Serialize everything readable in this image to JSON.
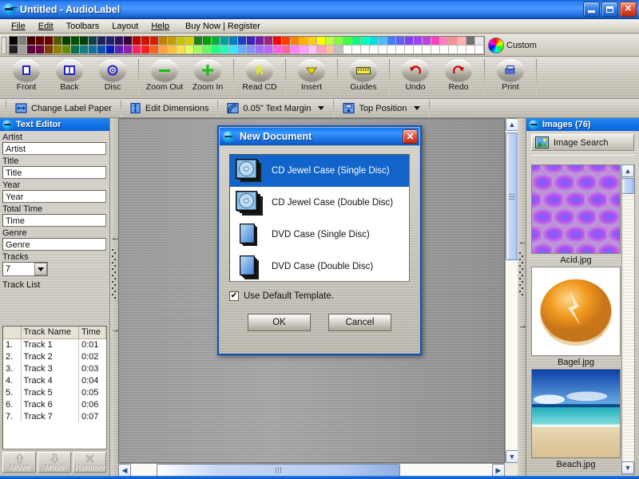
{
  "window": {
    "title": "Untitled - AudioLabel",
    "app_icon": "audiolabel-icon",
    "minimize_label": "Minimize",
    "maximize_label": "Restore",
    "close_label": "Close"
  },
  "menu": {
    "items": [
      {
        "label": "File",
        "accel": "F"
      },
      {
        "label": "Edit",
        "accel": "E"
      },
      {
        "label": "Toolbars",
        "accel": "T"
      },
      {
        "label": "Layout",
        "accel": "L"
      },
      {
        "label": "Help",
        "accel": "H"
      },
      {
        "label": "Buy Now | Register",
        "accel": ""
      }
    ]
  },
  "palette": {
    "custom_label": "Custom",
    "row1": [
      "#000000",
      "#808080",
      "#400000",
      "#600000",
      "#700000",
      "#585800",
      "#004000",
      "#005000",
      "#004008",
      "#104040",
      "#202060",
      "#202070",
      "#301060",
      "#380038",
      "#c00000",
      "#d01000",
      "#d02000",
      "#c08000",
      "#c0a000",
      "#c8c000",
      "#d0d000",
      "#208020",
      "#00a000",
      "#00b040",
      "#00a0a0",
      "#0080c0",
      "#2040c0",
      "#4020c0",
      "#7020a0",
      "#a02080",
      "#ff0000",
      "#ff4000",
      "#ff8000",
      "#ffb000",
      "#ffd000",
      "#ffff00",
      "#c0ff40",
      "#80ff40",
      "#40ff40",
      "#00ff80",
      "#00ffc0",
      "#00e0e0",
      "#40c0ff",
      "#4080ff",
      "#6060ff",
      "#8040ff",
      "#a040ff",
      "#c040e0",
      "#ff40c0",
      "#ff80c0",
      "#ff9090",
      "#ffb0b0",
      "#707070",
      "#e8e8e8"
    ],
    "row2": [
      "#202020",
      "#a0a0a0",
      "#600040",
      "#700040",
      "#804000",
      "#908000",
      "#609000",
      "#0a7050",
      "#108080",
      "#1070a0",
      "#1050b0",
      "#0020c0",
      "#6020c0",
      "#9020b0",
      "#ff2060",
      "#ff2020",
      "#ff6020",
      "#ffa040",
      "#ffc040",
      "#ffe040",
      "#e0ff60",
      "#a0ff60",
      "#60ff60",
      "#20ff80",
      "#20ffc0",
      "#40e0ff",
      "#60b0ff",
      "#8090ff",
      "#a070ff",
      "#c060ff",
      "#ff60e0",
      "#ff60a0",
      "#ff80ff",
      "#ffa0ff",
      "#ffc0ff",
      "#ffa0c0",
      "#ffc0a0",
      "#c0c0c0",
      "#ffffff"
    ]
  },
  "toolbar1": {
    "groups": [
      {
        "buttons": [
          {
            "label": "Front",
            "icon": "front-cover-icon"
          },
          {
            "label": "Back",
            "icon": "back-cover-icon"
          },
          {
            "label": "Disc",
            "icon": "disc-icon"
          }
        ]
      },
      {
        "buttons": [
          {
            "label": "Zoom Out",
            "icon": "zoom-out-icon"
          },
          {
            "label": "Zoom In",
            "icon": "zoom-in-icon"
          }
        ]
      },
      {
        "buttons": [
          {
            "label": "Read CD",
            "icon": "read-cd-icon"
          }
        ]
      },
      {
        "buttons": [
          {
            "label": "Insert",
            "icon": "insert-icon"
          }
        ]
      },
      {
        "buttons": [
          {
            "label": "Guides",
            "icon": "guides-icon"
          }
        ]
      },
      {
        "buttons": [
          {
            "label": "Undo",
            "icon": "undo-icon"
          },
          {
            "label": "Redo",
            "icon": "redo-icon"
          }
        ]
      },
      {
        "buttons": [
          {
            "label": "Print",
            "icon": "print-icon"
          }
        ]
      }
    ]
  },
  "toolbar2": {
    "items": [
      {
        "label": "Change Label Paper",
        "icon": "label-paper-icon",
        "dropdown": false
      },
      {
        "label": "Edit Dimensions",
        "icon": "dimensions-icon",
        "dropdown": false
      },
      {
        "label": "0.05\" Text Margin",
        "icon": "text-margin-icon",
        "dropdown": true
      },
      {
        "label": "Top Position",
        "icon": "top-position-icon",
        "dropdown": true
      }
    ]
  },
  "text_editor": {
    "panel_title": "Text Editor",
    "fields": [
      {
        "label": "Artist",
        "value": "Artist"
      },
      {
        "label": "Title",
        "value": "Title"
      },
      {
        "label": "Year",
        "value": "Year"
      },
      {
        "label": "Total Time",
        "value": "Time"
      },
      {
        "label": "Genre",
        "value": "Genre"
      }
    ],
    "tracks_label": "Tracks",
    "tracks_count": "7",
    "track_list_label": "Track List",
    "columns": [
      "",
      "Track Name",
      "Time"
    ],
    "rows": [
      {
        "num": "1.",
        "name": "Track 1",
        "time": "0:01"
      },
      {
        "num": "2.",
        "name": "Track 2",
        "time": "0:02"
      },
      {
        "num": "3.",
        "name": "Track 3",
        "time": "0:03"
      },
      {
        "num": "4.",
        "name": "Track 4",
        "time": "0:04"
      },
      {
        "num": "5.",
        "name": "Track 5",
        "time": "0:05"
      },
      {
        "num": "6.",
        "name": "Track 6",
        "time": "0:06"
      },
      {
        "num": "7.",
        "name": "Track 7",
        "time": "0:07"
      }
    ],
    "buttons": [
      {
        "label": "Move",
        "icon": "arrow-up-icon"
      },
      {
        "label": "Move",
        "icon": "arrow-down-icon"
      },
      {
        "label": "Remove",
        "icon": "remove-x-icon"
      }
    ]
  },
  "images_panel": {
    "panel_title": "Images (76)",
    "search_button": "Image Search",
    "search_icon": "image-search-icon",
    "thumbnails": [
      {
        "name": "Acid.jpg",
        "kind": "acid-pattern"
      },
      {
        "name": "Bagel.jpg",
        "kind": "bagel-photo"
      },
      {
        "name": "Beach.jpg",
        "kind": "beach-photo"
      }
    ]
  },
  "dialog": {
    "title": "New Document",
    "icon": "audiolabel-icon",
    "close_label": "✕",
    "options": [
      {
        "label": "CD Jewel Case  (Single Disc)",
        "icon": "cd-case-single-icon",
        "selected": true
      },
      {
        "label": "CD Jewel Case  (Double Disc)",
        "icon": "cd-case-double-icon",
        "selected": false
      },
      {
        "label": "DVD Case  (Single Disc)",
        "icon": "dvd-case-single-icon",
        "selected": false
      },
      {
        "label": "DVD Case  (Double Disc)",
        "icon": "dvd-case-double-icon",
        "selected": false
      }
    ],
    "checkbox": {
      "label": "Use Default Template.",
      "checked": true,
      "glyph": "✔"
    },
    "ok_label": "OK",
    "cancel_label": "Cancel"
  },
  "scrollbars": {
    "up_glyph": "▲",
    "down_glyph": "▼",
    "left_glyph": "◀",
    "right_glyph": "▶"
  },
  "splitters": {
    "left_arrow_glyph": "←",
    "right_arrow_glyph": "→"
  },
  "colors": {
    "accent": "#1164c9",
    "titlebar": "#2e7ff0",
    "panel_header": "#0a63d8",
    "face": "#c6c2b6",
    "canvas": "#9b9b9b",
    "close_red": "#c22c12"
  }
}
